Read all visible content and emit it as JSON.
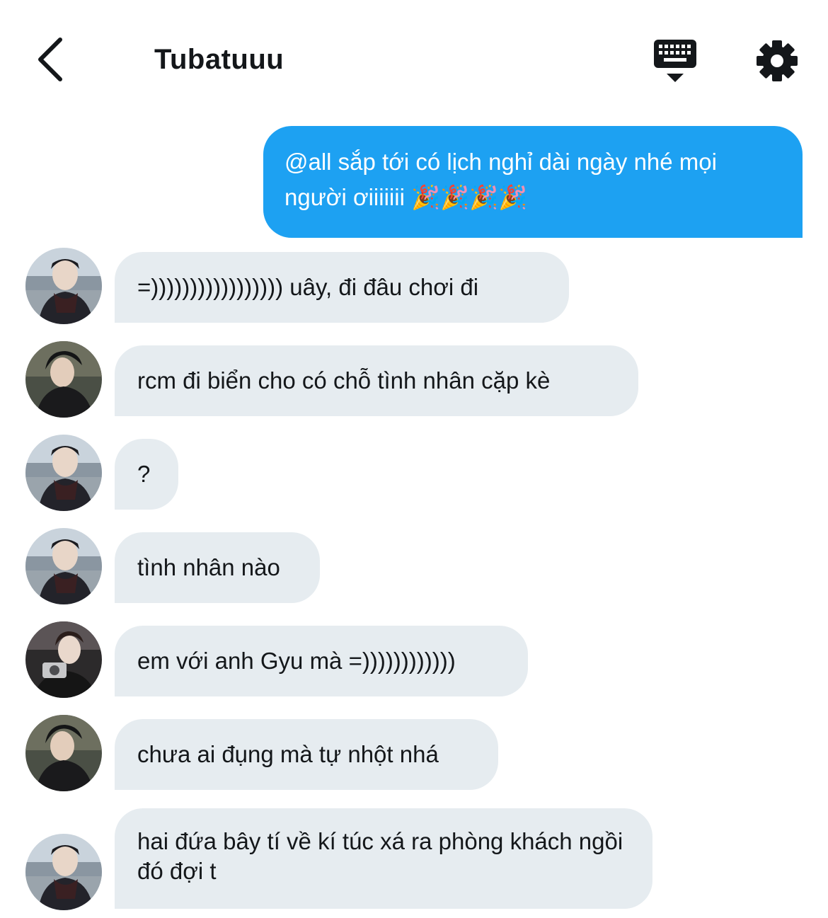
{
  "header": {
    "title": "Tubatuuu"
  },
  "icons": {
    "back": "chevron-left-icon",
    "keyboard": "keyboard-icon",
    "settings": "gear-icon"
  },
  "colors": {
    "outgoing_bubble": "#1da1f2",
    "incoming_bubble": "#e6ecf0",
    "text": "#14171a"
  },
  "messages": [
    {
      "direction": "out",
      "text": "@all sắp tới có lịch nghỉ dài ngày nhé mọi người ơiiiiiii 🎉🎉🎉🎉"
    },
    {
      "direction": "in",
      "text": "=))))))))))))))))) uây, đi đâu chơi đi"
    },
    {
      "direction": "in",
      "text": "rcm đi biển cho có chỗ tình nhân cặp kè"
    },
    {
      "direction": "in",
      "text": "?"
    },
    {
      "direction": "in",
      "text": "tình nhân nào"
    },
    {
      "direction": "in",
      "text": "em với anh Gyu mà =))))))))))))"
    },
    {
      "direction": "in",
      "text": "chưa ai đụng mà tự nhột nhá"
    },
    {
      "direction": "in",
      "text": "hai đứa bây tí về kí túc xá ra phòng khách ngồi đó đợi t"
    }
  ]
}
